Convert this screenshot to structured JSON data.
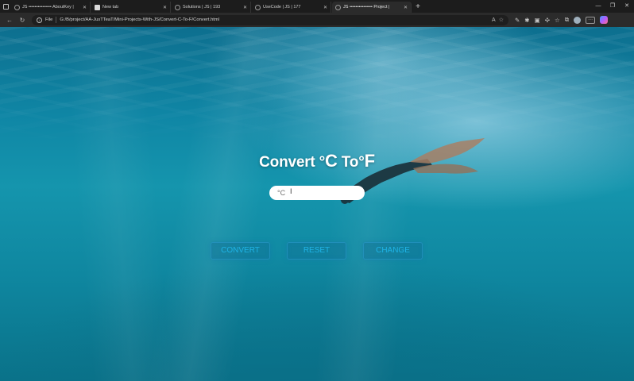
{
  "browser": {
    "tabs": [
      {
        "title": "JS ••••••••••••••• AboutKey |",
        "active": false
      },
      {
        "title": "New tab",
        "active": false
      },
      {
        "title": "Solutions | JS | 193",
        "active": false
      },
      {
        "title": "UseCode | JS | 177",
        "active": false
      },
      {
        "title": "JS ••••••••••••••• Project |",
        "active": true
      }
    ],
    "new_tab_label": "+",
    "url_scheme": "File",
    "url": "G:/B/project/AA-JusTTeaT/Mini-Projects-With-JS/Convert-C-To-F/Convert.html"
  },
  "page": {
    "heading_part1": "Convert °",
    "heading_c": "C",
    "heading_part2": " To°",
    "heading_f": "F",
    "input_placeholder": "°C",
    "input_value": "",
    "buttons": {
      "convert": "CONVERT",
      "reset": "RESET",
      "change": "CHANGE"
    }
  },
  "colors": {
    "button_text": "#1fb3e6",
    "heading": "#ffffff",
    "water": "#1595ad"
  },
  "icons": [
    "back-icon",
    "refresh-icon",
    "info-icon",
    "read-aloud-icon",
    "favorite-icon",
    "extensions-icon",
    "profile-avatar",
    "more-icon",
    "copilot-icon"
  ]
}
